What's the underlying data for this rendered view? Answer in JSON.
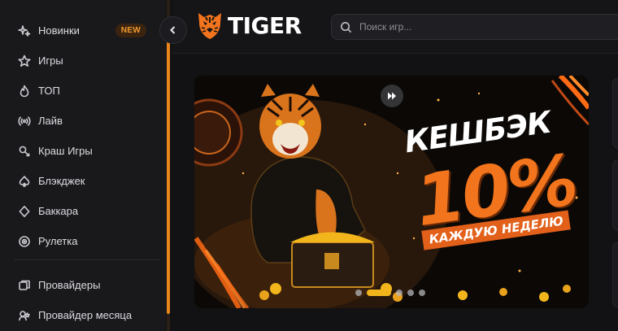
{
  "brand": {
    "name": "TIGER"
  },
  "search": {
    "placeholder": "Поиск игр..."
  },
  "sidebar": {
    "items": [
      {
        "label": "Новинки",
        "icon": "sparkles-icon",
        "badge": "NEW"
      },
      {
        "label": "Игры",
        "icon": "star-icon"
      },
      {
        "label": "ТОП",
        "icon": "flame-icon"
      },
      {
        "label": "Лайв",
        "icon": "broadcast-icon"
      },
      {
        "label": "Краш Игры",
        "icon": "rocket-icon"
      },
      {
        "label": "Блэкджек",
        "icon": "spade-icon"
      },
      {
        "label": "Баккара",
        "icon": "diamond-icon"
      },
      {
        "label": "Рулетка",
        "icon": "roulette-icon"
      }
    ],
    "items2": [
      {
        "label": "Провайдеры",
        "icon": "providers-icon"
      },
      {
        "label": "Провайдер месяца",
        "icon": "provider-month-icon"
      }
    ]
  },
  "banner": {
    "title": "КЕШБЭК",
    "percent": "10%",
    "subtitle": "КАЖДУЮ НЕДЕЛЮ",
    "slides_total": 5,
    "active_slide": 2
  },
  "colors": {
    "accent": "#f2741c",
    "badge_text": "#f2992e",
    "dot_active": "#f2b61c"
  }
}
